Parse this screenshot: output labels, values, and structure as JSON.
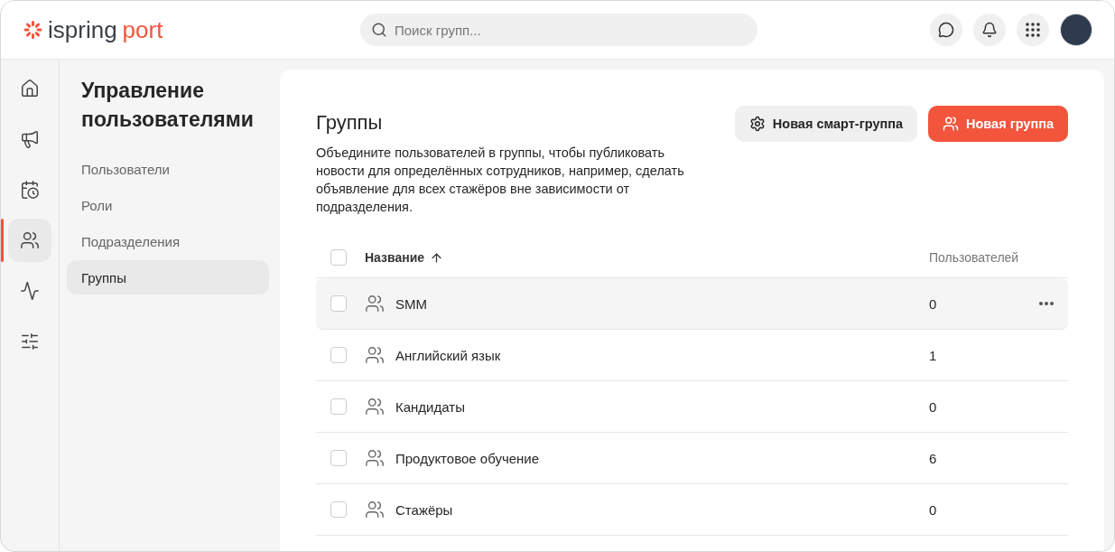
{
  "header": {
    "logo": {
      "part_1": "ispring",
      "part_2": "port"
    },
    "search": {
      "placeholder": "Поиск групп..."
    }
  },
  "rail": [
    {
      "selected": false
    },
    {
      "selected": false
    },
    {
      "selected": false
    },
    {
      "selected": true
    },
    {
      "selected": false
    },
    {
      "selected": false
    }
  ],
  "subnav": {
    "title": "Управление пользователями",
    "items": [
      {
        "label": "Пользователи",
        "selected": false
      },
      {
        "label": "Роли",
        "selected": false
      },
      {
        "label": "Подразделения",
        "selected": false
      },
      {
        "label": "Группы",
        "selected": true
      }
    ]
  },
  "main": {
    "title": "Группы",
    "description": "Объедините пользователей в группы, чтобы публиковать новости для определённых сотрудников, например, сделать объявление для всех стажёров вне зависимости от подразделения.",
    "buttons": [
      {
        "kind": "secondary",
        "label": "Новая смарт-группа"
      },
      {
        "kind": "primary",
        "label": "Новая группа"
      }
    ],
    "table": {
      "columns": [
        "Название",
        "Пользователей"
      ],
      "checked": false,
      "rows": [
        {
          "name": "SMM",
          "users": "0",
          "checked": false,
          "highlighted": true
        },
        {
          "name": "Английский язык",
          "users": "1",
          "checked": false,
          "highlighted": false
        },
        {
          "name": "Кандидаты",
          "users": "0",
          "checked": false,
          "highlighted": false
        },
        {
          "name": "Продуктовое обучение",
          "users": "6",
          "checked": false,
          "highlighted": false
        },
        {
          "name": "Стажёры",
          "users": "0",
          "checked": false,
          "highlighted": false
        }
      ]
    }
  }
}
